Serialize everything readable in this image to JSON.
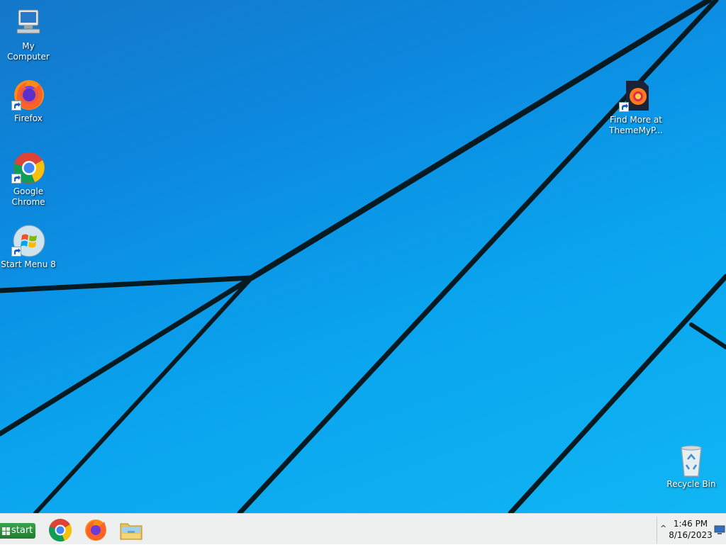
{
  "desktop": {
    "icons": [
      {
        "label": "My Computer",
        "icon": "computer-icon"
      },
      {
        "label": "Firefox",
        "icon": "firefox-icon"
      },
      {
        "label": "Google Chrome",
        "icon": "chrome-icon"
      },
      {
        "label": "Start Menu 8",
        "icon": "windows-orb-icon"
      },
      {
        "label": "Find More at ThemeMyP...",
        "icon": "firefox-theme-icon"
      },
      {
        "label": "Recycle Bin",
        "icon": "recycle-bin-icon"
      }
    ]
  },
  "taskbar": {
    "start_label": "start",
    "pinned": [
      {
        "icon": "chrome-icon"
      },
      {
        "icon": "firefox-icon"
      },
      {
        "icon": "file-explorer-icon"
      }
    ],
    "tray": {
      "chevron": "^",
      "time": "1:46 PM",
      "date": "8/16/2023"
    }
  },
  "colors": {
    "desktop_blue": "#0aa4ee",
    "start_green": "#2e8f3c",
    "taskbar_bg": "#eef0f0"
  }
}
